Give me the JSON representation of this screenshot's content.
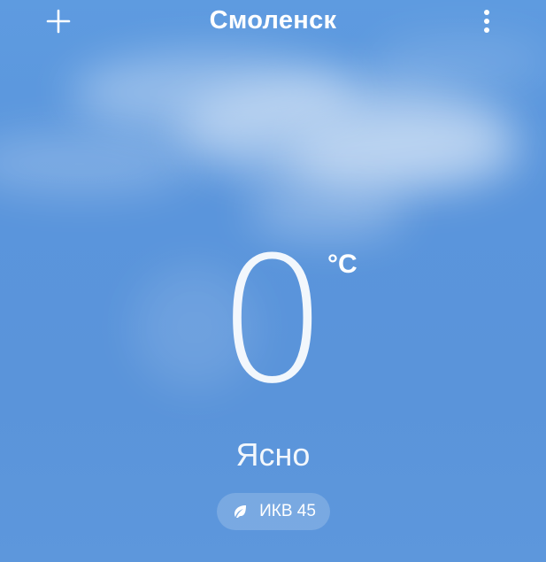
{
  "header": {
    "city": "Смоленск",
    "add_icon": "plus-icon",
    "menu_icon": "more-vertical-icon"
  },
  "weather": {
    "temperature": "0",
    "unit": "°C",
    "condition": "Ясно"
  },
  "air_quality": {
    "label": "ИКВ 45",
    "icon": "leaf-icon"
  },
  "colors": {
    "sky_top": "#5e9be0",
    "sky_bottom": "#5d97dc",
    "text": "#ffffff"
  }
}
